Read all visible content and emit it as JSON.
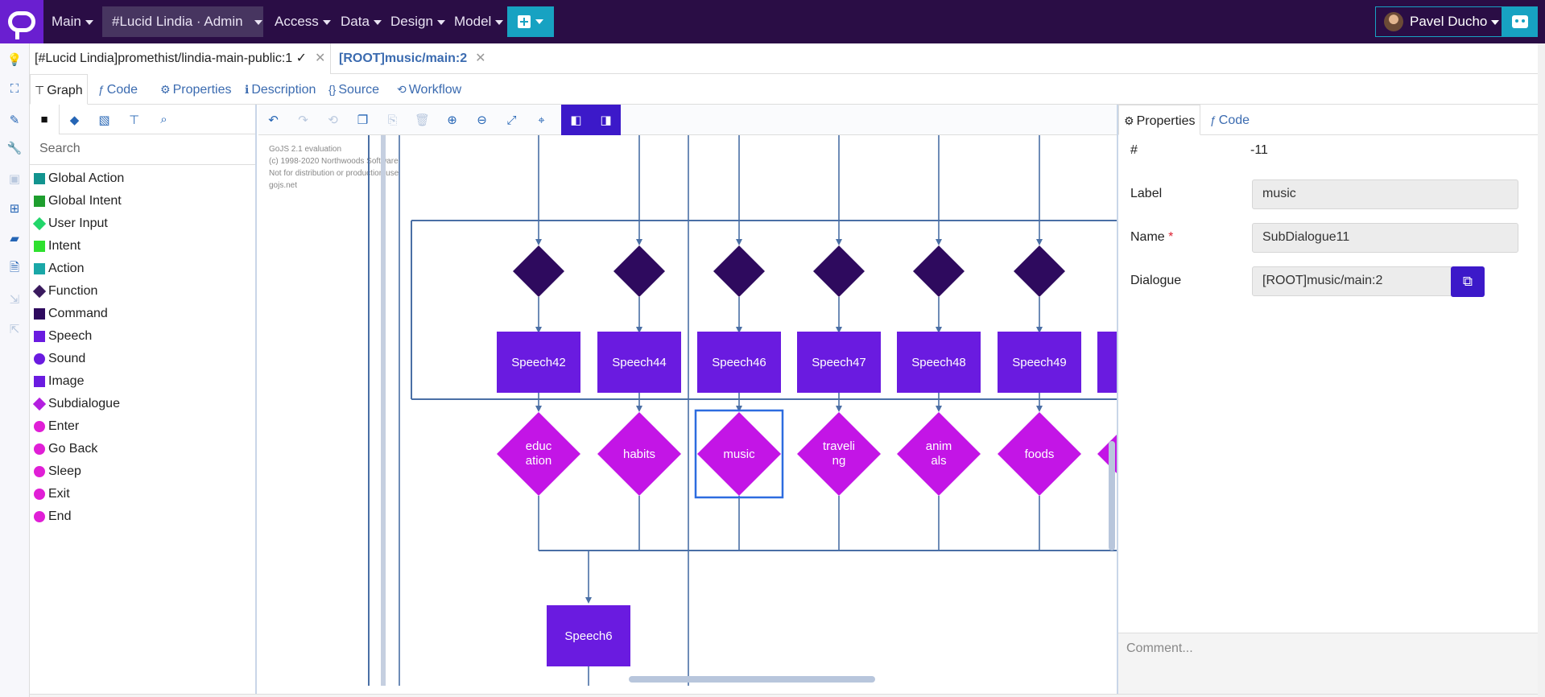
{
  "navbar": {
    "menus": [
      "Main",
      "Access",
      "Data",
      "Design",
      "Model"
    ],
    "project": "#Lucid Lindia · Admin",
    "user": "Pavel Ducho",
    "brand_color": "#2a0d45",
    "accent_color": "#17a2c2"
  },
  "doc_tabs": [
    {
      "label": "[#Lucid Lindia]promethist/lindia-main-public:1 ✓"
    },
    {
      "label": "[ROOT]music/main:2"
    }
  ],
  "view_tabs": [
    "Graph",
    "Code",
    "Properties",
    "Description",
    "Source",
    "Workflow"
  ],
  "palette": {
    "search_placeholder": "Search",
    "items": [
      {
        "label": "Global Action",
        "color": "#12948f",
        "shape": "square"
      },
      {
        "label": "Global Intent",
        "color": "#1e9e2e",
        "shape": "square"
      },
      {
        "label": "User Input",
        "color": "#22d66a",
        "shape": "diamond"
      },
      {
        "label": "Intent",
        "color": "#2ee02e",
        "shape": "square"
      },
      {
        "label": "Action",
        "color": "#1aa7a7",
        "shape": "square"
      },
      {
        "label": "Function",
        "color": "#3a1a5e",
        "shape": "diamond"
      },
      {
        "label": "Command",
        "color": "#2e0a5e",
        "shape": "square"
      },
      {
        "label": "Speech",
        "color": "#6a1be0",
        "shape": "square"
      },
      {
        "label": "Sound",
        "color": "#6a1be0",
        "shape": "circle"
      },
      {
        "label": "Image",
        "color": "#6a1be0",
        "shape": "square"
      },
      {
        "label": "Subdialogue",
        "color": "#b41fe0",
        "shape": "diamond"
      },
      {
        "label": "Enter",
        "color": "#e01fd6",
        "shape": "circle"
      },
      {
        "label": "Go Back",
        "color": "#e01fd6",
        "shape": "circle"
      },
      {
        "label": "Sleep",
        "color": "#e01fd6",
        "shape": "circle"
      },
      {
        "label": "Exit",
        "color": "#e01fd6",
        "shape": "circle"
      },
      {
        "label": "End",
        "color": "#e01fd6",
        "shape": "circle"
      }
    ]
  },
  "canvas": {
    "watermark": [
      "GoJS 2.1 evaluation",
      "(c) 1998-2020 Northwoods Software",
      "Not for distribution or production use",
      "gojs.net"
    ],
    "speech_nodes": [
      "Speech42",
      "Speech44",
      "Speech46",
      "Speech47",
      "Speech48",
      "Speech49"
    ],
    "subdialogue_nodes": [
      [
        "educ",
        "ation"
      ],
      [
        "habits"
      ],
      [
        "music"
      ],
      [
        "traveli",
        "ng"
      ],
      [
        "anim",
        "als"
      ],
      [
        "foods"
      ]
    ],
    "selected_index": 2,
    "bottom_node": "Speech6"
  },
  "properties": {
    "tabs": [
      "Properties",
      "Code"
    ],
    "id_label": "#",
    "id_value": "-11",
    "label_label": "Label",
    "label_value": "music",
    "name_label": "Name",
    "name_required": "*",
    "name_value": "SubDialogue11",
    "dialogue_label": "Dialogue",
    "dialogue_value": "[ROOT]music/main:2",
    "comment_placeholder": "Comment..."
  }
}
